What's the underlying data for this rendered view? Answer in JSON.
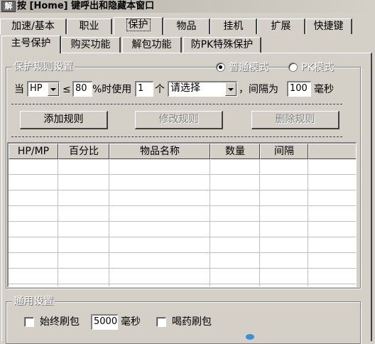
{
  "window": {
    "sys_icon": "解",
    "title": "按 [Home] 键呼出和隐藏本窗口"
  },
  "tabs_top": [
    {
      "label": "加速/基本"
    },
    {
      "label": "职业"
    },
    {
      "label": "保护"
    },
    {
      "label": "物品"
    },
    {
      "label": "挂机"
    },
    {
      "label": "扩展"
    },
    {
      "label": "快捷键"
    }
  ],
  "tabs_sub": [
    {
      "label": "主号保护"
    },
    {
      "label": "购买功能"
    },
    {
      "label": "解包功能"
    },
    {
      "label": "防PK特殊保护"
    }
  ],
  "rules_group": {
    "legend": "保护规则设置",
    "mode_normal": "普通模式",
    "mode_pk": "PK模式",
    "mode_selected": "普通模式"
  },
  "rule_row": {
    "when_label": "当",
    "stat_value": "HP",
    "le_label": "≤",
    "percent_value": "80",
    "use_label": "%时使用",
    "count_value": "1",
    "unit_label": "个",
    "item_value": "请选择",
    "interval_label": "，间隔为",
    "interval_value": "100",
    "ms_label": "毫秒"
  },
  "buttons": {
    "add": "添加规则",
    "edit": "修改规则",
    "delete": "删除规则"
  },
  "table": {
    "columns": [
      "HP/MP",
      "百分比",
      "物品名称",
      "数量",
      "间隔"
    ],
    "rows": []
  },
  "general_group": {
    "legend": "通用设置",
    "always_refresh_label": "始终刷包",
    "always_refresh_checked": false,
    "refresh_ms_value": "5000",
    "refresh_ms_unit": "毫秒",
    "drink_refresh_label": "喝药刷包",
    "drink_refresh_checked": false
  }
}
